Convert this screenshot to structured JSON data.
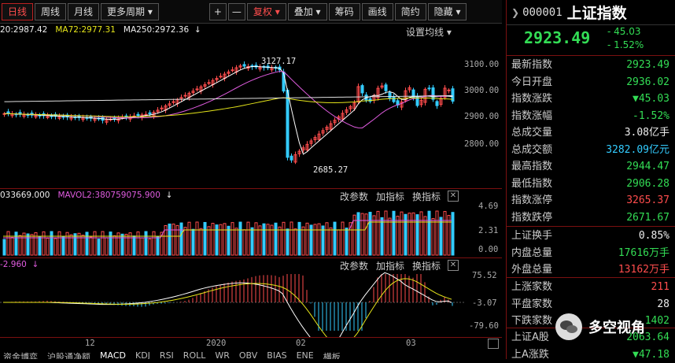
{
  "toolbar": {
    "buttons": [
      "日线",
      "周线",
      "月线",
      "更多周期 ▾"
    ],
    "plus": "+",
    "minus": "—",
    "right_buttons": [
      "复权 ▾",
      "叠加 ▾",
      "筹码",
      "画线",
      "简约",
      "隐藏 ▾"
    ]
  },
  "main_legend": {
    "ma_a": "20:2987.42",
    "ma72": "MA72:2977.31",
    "ma250": "MA250:2972.36",
    "arrow": "↓",
    "settings": "设置均线 ▾",
    "high_label": "3127.17",
    "low_label": "2685.27"
  },
  "price_axis": [
    "3100.00",
    "3000.00",
    "2900.00",
    "2800.00"
  ],
  "vol_panel": {
    "legend_a": "033669.000",
    "legend_b": "MAVOL2:380759075.900",
    "arrow": "↓",
    "buttons": [
      "改参数",
      "加指标",
      "换指标"
    ],
    "close": "✕",
    "axis": [
      "4.69",
      "2.31",
      "0.00"
    ]
  },
  "macd_panel": {
    "legend": "-2.960",
    "arrow": "↓",
    "buttons": [
      "改参数",
      "加指标",
      "换指标"
    ],
    "close": "✕",
    "axis": [
      "75.52",
      "-3.07",
      "-79.60"
    ]
  },
  "x_axis": [
    "12",
    "2020",
    "02",
    "03"
  ],
  "bottom_tabs": [
    "资金博弈",
    "沪股通净额",
    "MACD",
    "KDJ",
    "RSI",
    "ROLL",
    "WR",
    "OBV",
    "BIAS",
    "ENE",
    "横板"
  ],
  "quote": {
    "code": "000001",
    "name": "上证指数",
    "price": "2923.49",
    "change": "- 45.03",
    "pct": "- 1.52%",
    "rows": [
      {
        "label": "最新指数",
        "value": "2923.49",
        "color": "#33dd55"
      },
      {
        "label": "今日开盘",
        "value": "2936.02",
        "color": "#33dd55"
      },
      {
        "label": "指数涨跌",
        "value": "▼45.03",
        "color": "#33dd55"
      },
      {
        "label": "指数涨幅",
        "value": "-1.52%",
        "color": "#33dd55"
      },
      {
        "label": "总成交量",
        "value": "3.08亿手",
        "color": "#eeeeee"
      },
      {
        "label": "总成交额",
        "value": "3282.09亿元",
        "color": "#33ccff"
      },
      {
        "label": "最高指数",
        "value": "2944.47",
        "color": "#33dd55"
      },
      {
        "label": "最低指数",
        "value": "2906.28",
        "color": "#33dd55"
      },
      {
        "label": "指数涨停",
        "value": "3265.37",
        "color": "#ff4d4d"
      },
      {
        "label": "指数跌停",
        "value": "2671.67",
        "color": "#33dd55"
      }
    ],
    "rows2": [
      {
        "label": "上证换手",
        "value": "0.85%",
        "color": "#eeeeee"
      },
      {
        "label": "内盘总量",
        "value": "17616万手",
        "color": "#33dd55"
      },
      {
        "label": "外盘总量",
        "value": "13162万手",
        "color": "#ff4d4d"
      }
    ],
    "rows3": [
      {
        "label": "上涨家数",
        "value": "211",
        "color": "#ff4d4d"
      },
      {
        "label": "平盘家数",
        "value": "28",
        "color": "#eeeeee"
      },
      {
        "label": "下跌家数",
        "value": "1402",
        "color": "#33dd55"
      }
    ],
    "rows4": [
      {
        "label": "上证A股",
        "value": "2063.64",
        "color": "#33dd55"
      },
      {
        "label": "上A涨跌",
        "value": "▼47.18",
        "color": "#33dd55"
      }
    ]
  },
  "watermark": "多空视角",
  "colors": {
    "up": "#ff4d4d",
    "down": "#33ccff",
    "bg": "#000000",
    "grid": "#7a1010"
  }
}
